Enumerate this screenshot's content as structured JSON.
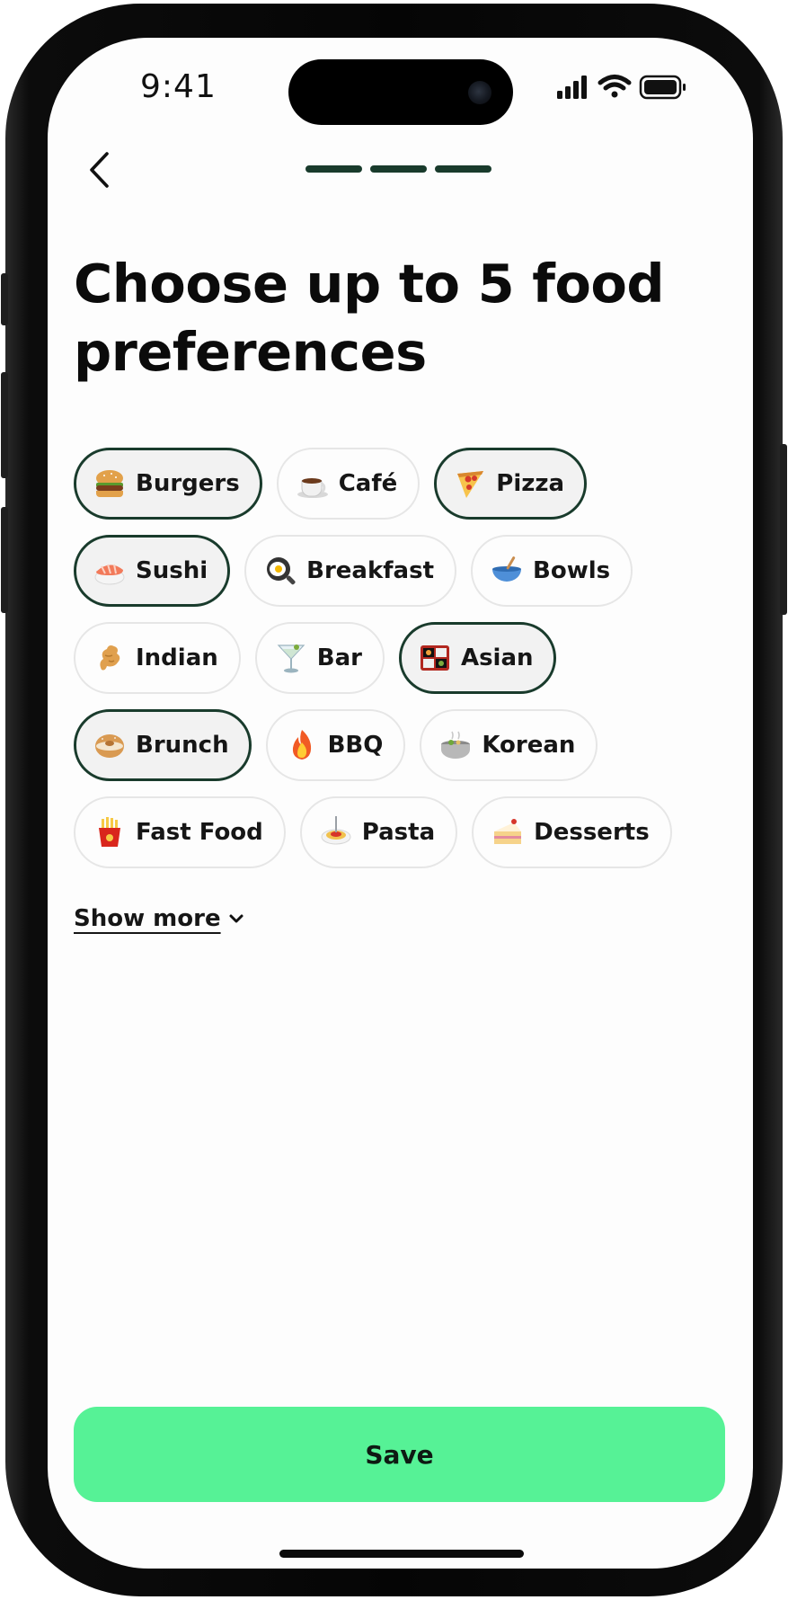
{
  "status_bar": {
    "time": "9:41",
    "icons": [
      "cellular-signal-icon",
      "wifi-icon",
      "battery-icon"
    ]
  },
  "nav": {
    "back_icon": "chevron-left-icon",
    "progress_steps_total": 3,
    "progress_steps_done": 3
  },
  "title": "Choose up to 5 food preferences",
  "preferences": [
    {
      "label": "Burgers",
      "emoji": "burger",
      "selected": true
    },
    {
      "label": "Café",
      "emoji": "coffee",
      "selected": false
    },
    {
      "label": "Pizza",
      "emoji": "pizza",
      "selected": true
    },
    {
      "label": "Sushi",
      "emoji": "sushi",
      "selected": true
    },
    {
      "label": "Breakfast",
      "emoji": "fried-egg",
      "selected": false
    },
    {
      "label": "Bowls",
      "emoji": "bowl",
      "selected": false
    },
    {
      "label": "Indian",
      "emoji": "ginger",
      "selected": false
    },
    {
      "label": "Bar",
      "emoji": "cocktail",
      "selected": false
    },
    {
      "label": "Asian",
      "emoji": "bento",
      "selected": true
    },
    {
      "label": "Brunch",
      "emoji": "bagel",
      "selected": true
    },
    {
      "label": "BBQ",
      "emoji": "fire",
      "selected": false
    },
    {
      "label": "Korean",
      "emoji": "pot",
      "selected": false
    },
    {
      "label": "Fast Food",
      "emoji": "fries",
      "selected": false
    },
    {
      "label": "Pasta",
      "emoji": "spaghetti",
      "selected": false
    },
    {
      "label": "Desserts",
      "emoji": "cake",
      "selected": false
    }
  ],
  "show_more": {
    "label": "Show more",
    "icon": "chevron-down-icon"
  },
  "save_button": {
    "label": "Save"
  },
  "colors": {
    "accent_dark_green": "#193b2c",
    "save_green": "#56f296",
    "selected_chip_bg": "#f2f2f2",
    "chip_border": "#e6e6e6"
  }
}
